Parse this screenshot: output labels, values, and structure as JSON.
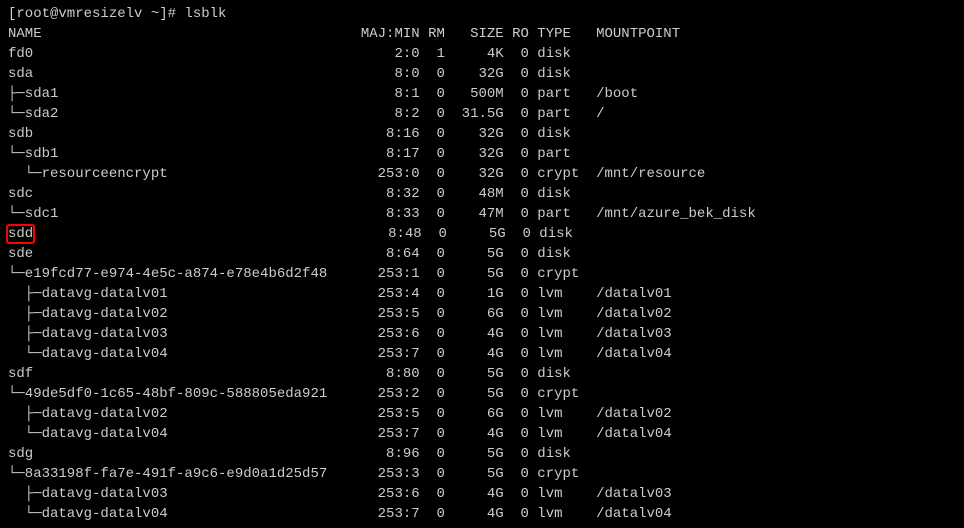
{
  "prompt": "[root@vmresizelv ~]# ",
  "command": "lsblk",
  "highlight_name": "sdd",
  "header": {
    "name": "NAME",
    "majmin": "MAJ:MIN",
    "rm": "RM",
    "size": "SIZE",
    "ro": "RO",
    "type": "TYPE",
    "mountpoint": "MOUNTPOINT"
  },
  "rows": [
    {
      "tree": "",
      "name": "fd0",
      "majmin": "2:0",
      "rm": "1",
      "size": "4K",
      "ro": "0",
      "type": "disk",
      "mount": ""
    },
    {
      "tree": "",
      "name": "sda",
      "majmin": "8:0",
      "rm": "0",
      "size": "32G",
      "ro": "0",
      "type": "disk",
      "mount": ""
    },
    {
      "tree": "├─",
      "name": "sda1",
      "majmin": "8:1",
      "rm": "0",
      "size": "500M",
      "ro": "0",
      "type": "part",
      "mount": "/boot"
    },
    {
      "tree": "└─",
      "name": "sda2",
      "majmin": "8:2",
      "rm": "0",
      "size": "31.5G",
      "ro": "0",
      "type": "part",
      "mount": "/"
    },
    {
      "tree": "",
      "name": "sdb",
      "majmin": "8:16",
      "rm": "0",
      "size": "32G",
      "ro": "0",
      "type": "disk",
      "mount": ""
    },
    {
      "tree": "└─",
      "name": "sdb1",
      "majmin": "8:17",
      "rm": "0",
      "size": "32G",
      "ro": "0",
      "type": "part",
      "mount": ""
    },
    {
      "tree": "  └─",
      "name": "resourceencrypt",
      "majmin": "253:0",
      "rm": "0",
      "size": "32G",
      "ro": "0",
      "type": "crypt",
      "mount": "/mnt/resource"
    },
    {
      "tree": "",
      "name": "sdc",
      "majmin": "8:32",
      "rm": "0",
      "size": "48M",
      "ro": "0",
      "type": "disk",
      "mount": ""
    },
    {
      "tree": "└─",
      "name": "sdc1",
      "majmin": "8:33",
      "rm": "0",
      "size": "47M",
      "ro": "0",
      "type": "part",
      "mount": "/mnt/azure_bek_disk"
    },
    {
      "tree": "",
      "name": "sdd",
      "highlight": true,
      "majmin": "8:48",
      "rm": "0",
      "size": "5G",
      "ro": "0",
      "type": "disk",
      "mount": ""
    },
    {
      "tree": "",
      "name": "sde",
      "majmin": "8:64",
      "rm": "0",
      "size": "5G",
      "ro": "0",
      "type": "disk",
      "mount": ""
    },
    {
      "tree": "└─",
      "name": "e19fcd77-e974-4e5c-a874-e78e4b6d2f48",
      "majmin": "253:1",
      "rm": "0",
      "size": "5G",
      "ro": "0",
      "type": "crypt",
      "mount": ""
    },
    {
      "tree": "  ├─",
      "name": "datavg-datalv01",
      "majmin": "253:4",
      "rm": "0",
      "size": "1G",
      "ro": "0",
      "type": "lvm",
      "mount": "/datalv01"
    },
    {
      "tree": "  ├─",
      "name": "datavg-datalv02",
      "majmin": "253:5",
      "rm": "0",
      "size": "6G",
      "ro": "0",
      "type": "lvm",
      "mount": "/datalv02"
    },
    {
      "tree": "  ├─",
      "name": "datavg-datalv03",
      "majmin": "253:6",
      "rm": "0",
      "size": "4G",
      "ro": "0",
      "type": "lvm",
      "mount": "/datalv03"
    },
    {
      "tree": "  └─",
      "name": "datavg-datalv04",
      "majmin": "253:7",
      "rm": "0",
      "size": "4G",
      "ro": "0",
      "type": "lvm",
      "mount": "/datalv04"
    },
    {
      "tree": "",
      "name": "sdf",
      "majmin": "8:80",
      "rm": "0",
      "size": "5G",
      "ro": "0",
      "type": "disk",
      "mount": ""
    },
    {
      "tree": "└─",
      "name": "49de5df0-1c65-48bf-809c-588805eda921",
      "majmin": "253:2",
      "rm": "0",
      "size": "5G",
      "ro": "0",
      "type": "crypt",
      "mount": ""
    },
    {
      "tree": "  ├─",
      "name": "datavg-datalv02",
      "majmin": "253:5",
      "rm": "0",
      "size": "6G",
      "ro": "0",
      "type": "lvm",
      "mount": "/datalv02"
    },
    {
      "tree": "  └─",
      "name": "datavg-datalv04",
      "majmin": "253:7",
      "rm": "0",
      "size": "4G",
      "ro": "0",
      "type": "lvm",
      "mount": "/datalv04"
    },
    {
      "tree": "",
      "name": "sdg",
      "majmin": "8:96",
      "rm": "0",
      "size": "5G",
      "ro": "0",
      "type": "disk",
      "mount": ""
    },
    {
      "tree": "└─",
      "name": "8a33198f-fa7e-491f-a9c6-e9d0a1d25d57",
      "majmin": "253:3",
      "rm": "0",
      "size": "5G",
      "ro": "0",
      "type": "crypt",
      "mount": ""
    },
    {
      "tree": "  ├─",
      "name": "datavg-datalv03",
      "majmin": "253:6",
      "rm": "0",
      "size": "4G",
      "ro": "0",
      "type": "lvm",
      "mount": "/datalv03"
    },
    {
      "tree": "  └─",
      "name": "datavg-datalv04",
      "majmin": "253:7",
      "rm": "0",
      "size": "4G",
      "ro": "0",
      "type": "lvm",
      "mount": "/datalv04"
    }
  ]
}
